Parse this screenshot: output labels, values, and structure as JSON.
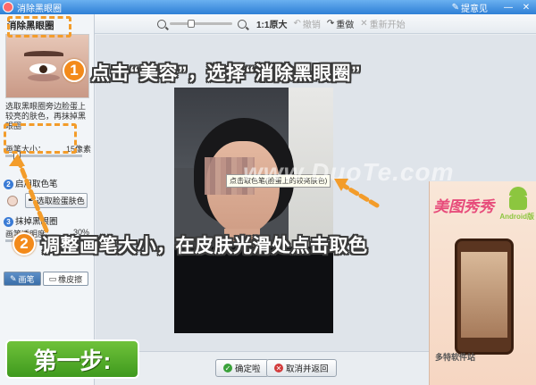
{
  "window": {
    "title": "消除黑眼圈",
    "feedback": "提意见",
    "minimize": "—",
    "close": "✕"
  },
  "toolbar": {
    "zoom_ratio": "1:1原大",
    "undo": "撤销",
    "redo": "重做",
    "reset": "重新开始"
  },
  "left_panel": {
    "title": "消除黑眼圈",
    "description": "选取黑眼圈旁边脸蛋上较亮的肤色，再抹掉黑眼圈",
    "brush_label": "画笔大小：",
    "brush_value": "15像素",
    "brush_level": 0.12,
    "section2_num": "2",
    "section2_title": "启用取色笔",
    "pick_color_button": "选取脸蛋肤色",
    "section3_num": "3",
    "section3_title": "抹掉黑眼圈",
    "transparency_label": "画笔透明度：",
    "transparency_value": "30%",
    "transparency_level": 0.3,
    "tab_brush": "画笔",
    "tab_eraser": "橡皮擦",
    "selected_color": "#f0d8cc"
  },
  "canvas": {
    "tooltip": "点击取色笔(脸蛋上的较亮肤色)",
    "watermark": "www.DuoTe.com"
  },
  "buttons": {
    "ok": "确定啦",
    "cancel": "取消并返回"
  },
  "ad": {
    "title": "美图秀秀",
    "android": "Android版",
    "site": "多特软件站"
  },
  "overlays": {
    "badge1": "1",
    "callout1": "点击“美容”，选择“消除黑眼圈”",
    "badge2": "2",
    "callout2": "调整画笔大小，在皮肤光滑处点击取色",
    "step_banner": "第一步:"
  },
  "colors": {
    "accent_orange": "#f38a1a",
    "step_green": "#4fa82a",
    "titlebar_blue": "#2e7fd6"
  }
}
